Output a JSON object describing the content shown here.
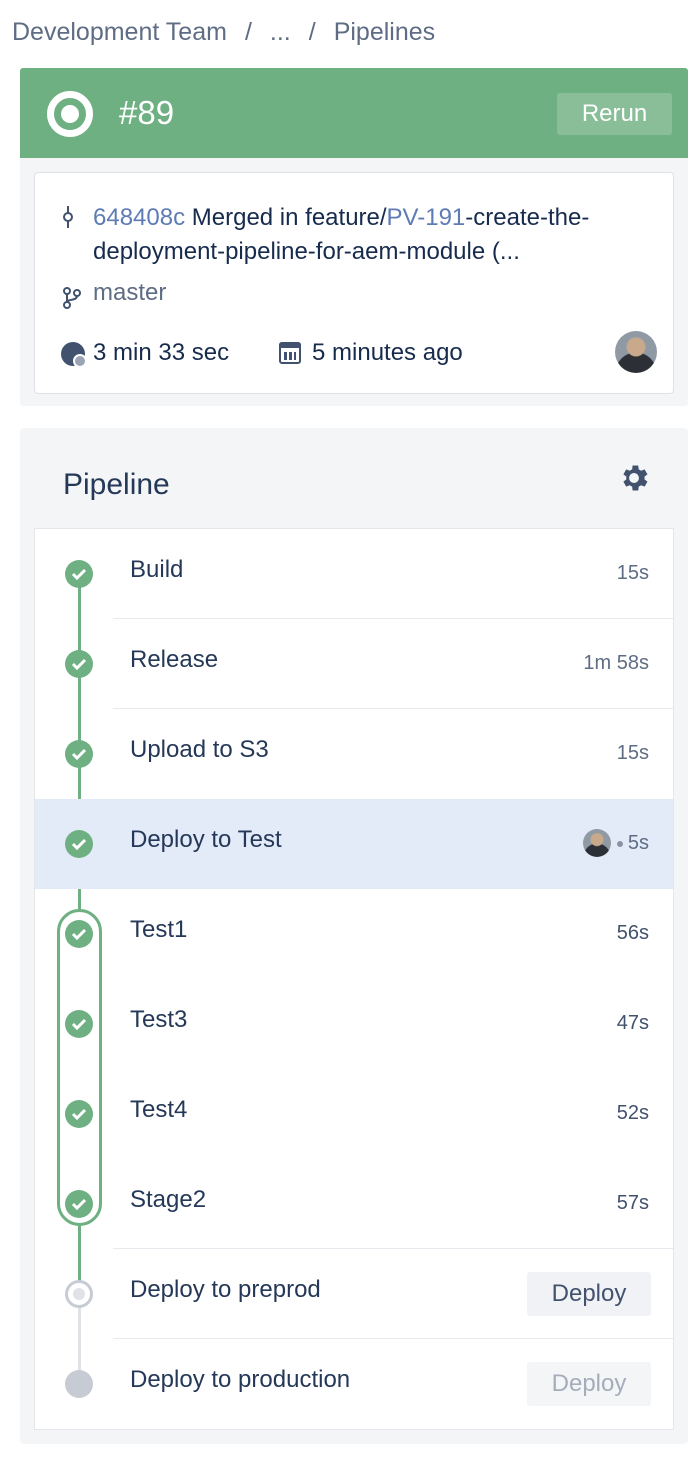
{
  "breadcrumb": {
    "items": [
      "Development Team",
      "...",
      "Pipelines"
    ],
    "separator": "/"
  },
  "header": {
    "run_number": "#89",
    "rerun_label": "Rerun",
    "status_color": "#6fb083"
  },
  "commit": {
    "hash": "648408c",
    "message_prefix": "Merged in feature/",
    "issue_key": "PV-191",
    "message_suffix": "-create-the-deployment-pipeline-for-aem-module (...",
    "branch": "master",
    "duration": "3 min 33 sec",
    "started": "5 minutes ago"
  },
  "pipeline": {
    "title": "Pipeline",
    "steps": [
      {
        "name": "Build",
        "time": "15s",
        "status": "success"
      },
      {
        "name": "Release",
        "time": "1m 58s",
        "status": "success"
      },
      {
        "name": "Upload to S3",
        "time": "15s",
        "status": "success"
      },
      {
        "name": "Deploy to Test",
        "time": "5s",
        "status": "success"
      },
      {
        "name": "Test1",
        "time": "56s",
        "status": "success"
      },
      {
        "name": "Test3",
        "time": "47s",
        "status": "success"
      },
      {
        "name": "Test4",
        "time": "52s",
        "status": "success"
      },
      {
        "name": "Stage2",
        "time": "57s",
        "status": "success"
      },
      {
        "name": "Deploy to preprod",
        "action": "Deploy",
        "status": "pending"
      },
      {
        "name": "Deploy to production",
        "action": "Deploy",
        "status": "locked"
      }
    ]
  }
}
